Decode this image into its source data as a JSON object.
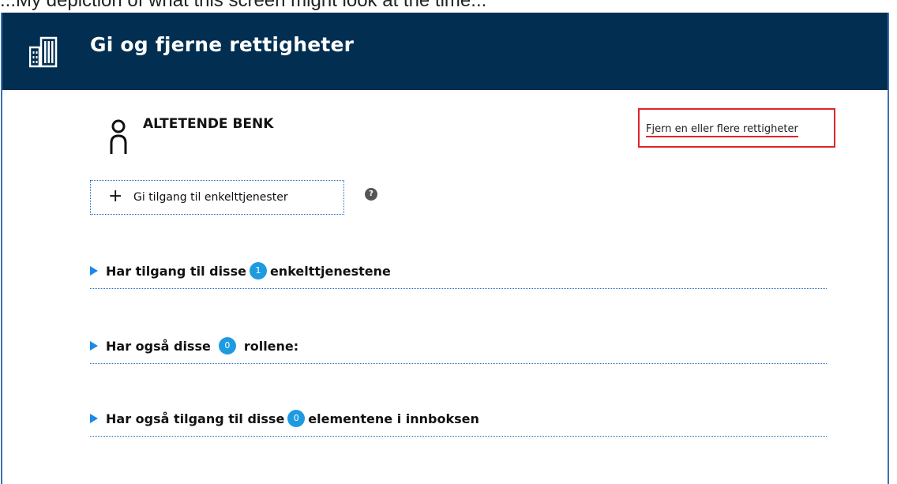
{
  "top_strip": {
    "text": "...My depiction of what this screen might look at the time..."
  },
  "header": {
    "logo": "building-logo",
    "title": "Gi og fjerne rettigheter"
  },
  "person": {
    "icon": "person-icon",
    "name": "ALTETENDE BENK"
  },
  "actions": {
    "remove_link": "Fjern en eller flere rettigheter",
    "grant_button": "Gi tilgang til enkelttjenester",
    "grant_icon": "plus-icon",
    "help": "?"
  },
  "sections": [
    {
      "prefix": "Har tilgang til disse",
      "count": "1",
      "suffix": "enkelttjenestene"
    },
    {
      "prefix": "Har også disse",
      "count": "0",
      "suffix": "rollene:"
    },
    {
      "prefix": "Har også tilgang til disse",
      "count": "0",
      "suffix": "elementene i innboksen"
    }
  ],
  "colors": {
    "header_bg": "#022f51",
    "accent_blue": "#1e9be0",
    "highlight_red": "#e2222a"
  }
}
